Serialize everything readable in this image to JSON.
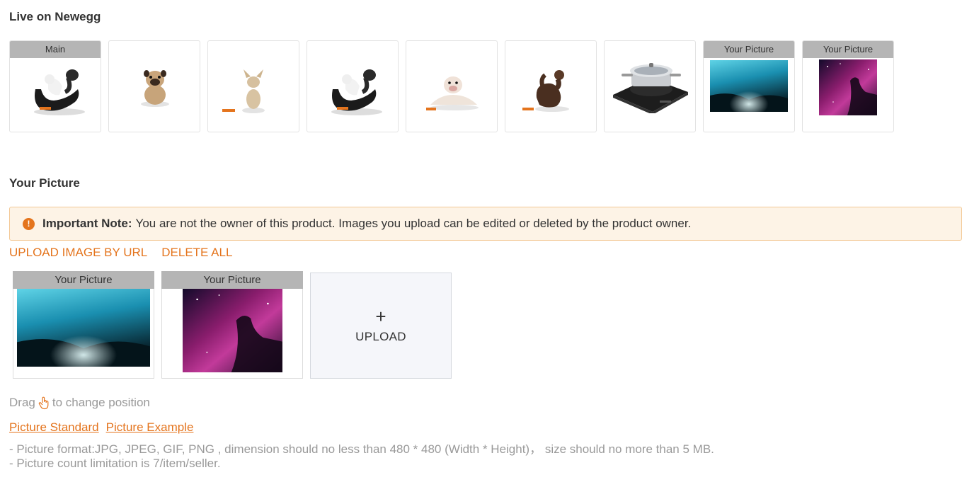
{
  "live": {
    "title": "Live on Newegg",
    "thumbnails": [
      {
        "tag": "Main",
        "icon": "dog-stretch-image"
      },
      {
        "tag": "",
        "icon": "pug-image"
      },
      {
        "tag": "",
        "icon": "chihuahua-image"
      },
      {
        "tag": "",
        "icon": "dog-stretch-image"
      },
      {
        "tag": "",
        "icon": "bulldog-image"
      },
      {
        "tag": "",
        "icon": "brown-dog-image"
      },
      {
        "tag": "",
        "icon": "cooktop-pot-image"
      },
      {
        "tag": "Your Picture",
        "icon": "ice-cave-image"
      },
      {
        "tag": "Your Picture",
        "icon": "nebula-image"
      }
    ]
  },
  "your_picture": {
    "title": "Your Picture",
    "note_label": "Important Note:",
    "note_text": "You are not the owner of this product. Images you upload can be edited or deleted by the product owner.",
    "upload_by_url": "UPLOAD IMAGE BY URL",
    "delete_all": "DELETE ALL",
    "cards": [
      {
        "tag": "Your Picture",
        "icon": "ice-cave-image"
      },
      {
        "tag": "Your Picture",
        "icon": "nebula-image"
      }
    ],
    "upload_plus": "+",
    "upload_label": "UPLOAD",
    "drag_before": "Drag",
    "drag_after": "to change position",
    "picture_standard": "Picture Standard",
    "picture_example": "Picture Example",
    "requirement_format": "- Picture format:JPG, JPEG, GIF, PNG , dimension should no less than 480 * 480 (Width * Height)， size should no more than 5 MB.",
    "requirement_count": "- Picture count limitation is 7/item/seller."
  },
  "colors": {
    "accent": "#e4741d",
    "note_bg": "#fdf3e6",
    "tag_bg": "#b5b5b5"
  }
}
